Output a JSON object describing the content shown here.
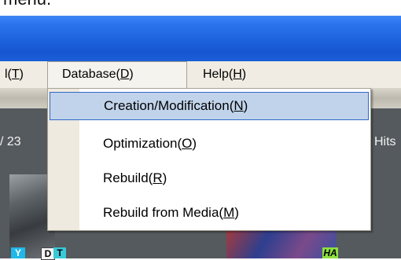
{
  "caption": {
    "text": "menu."
  },
  "menubar": {
    "items": [
      {
        "label": "",
        "mnemonic": "T",
        "suffix": ")",
        "prefix": "l("
      },
      {
        "label": "Database(",
        "mnemonic": "D",
        "suffix": ")"
      },
      {
        "label": "Help(",
        "mnemonic": "H",
        "suffix": ")"
      }
    ]
  },
  "dropdown": {
    "items": [
      {
        "label": "Creation/Modification(",
        "mnemonic": "N",
        "suffix": ")",
        "highlighted": true
      },
      {
        "label": "Optimization(",
        "mnemonic": "O",
        "suffix": ")",
        "highlighted": false
      },
      {
        "label": "Rebuild(",
        "mnemonic": "R",
        "suffix": ")",
        "highlighted": false
      },
      {
        "label": "Rebuild from Media(",
        "mnemonic": "M",
        "suffix": ")",
        "highlighted": false
      }
    ]
  },
  "content": {
    "left_count": "/ 23",
    "right_text": "Hits",
    "badges": {
      "y": "Y",
      "d": "D",
      "t": "T",
      "ha": "HA"
    }
  },
  "colors": {
    "titlebar": "#1d62dd",
    "highlight_bg": "#c1d3ea",
    "highlight_border": "#3168c8"
  }
}
